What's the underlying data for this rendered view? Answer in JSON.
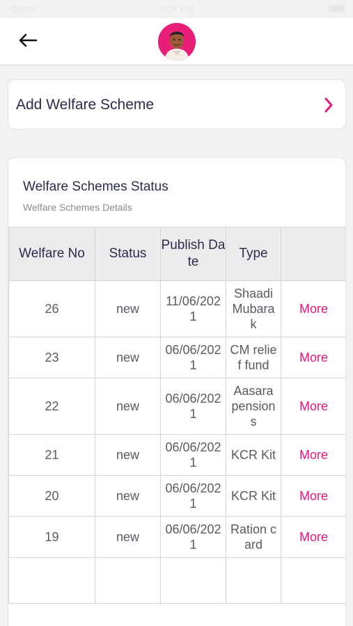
{
  "status_bar": {
    "carrier": "Carrier",
    "time": "7:34 PM"
  },
  "header": {
    "back_icon": "arrow-left-icon",
    "avatar_icon": "profile-avatar",
    "accent_color": "#e91e78"
  },
  "add_card": {
    "label": "Add Welfare Scheme",
    "chevron_icon": "chevron-right-icon",
    "chevron_color": "#e6197a"
  },
  "status_card": {
    "title": "Welfare Schemes Status",
    "subtitle": "Welfare Schemes Details",
    "columns": [
      "Welfare No",
      "Status",
      "Publish Date",
      "Type",
      ""
    ],
    "rows": [
      {
        "no": "26",
        "status": "new",
        "date": "11/06/2021",
        "type": "Shaadi Mubarak",
        "action": "More"
      },
      {
        "no": "23",
        "status": "new",
        "date": "06/06/2021",
        "type": "CM relief fund",
        "action": "More"
      },
      {
        "no": "22",
        "status": "new",
        "date": "06/06/2021",
        "type": "Aasara pensions",
        "action": "More"
      },
      {
        "no": "21",
        "status": "new",
        "date": "06/06/2021",
        "type": "KCR Kit",
        "action": "More"
      },
      {
        "no": "20",
        "status": "new",
        "date": "06/06/2021",
        "type": "KCR Kit",
        "action": "More"
      },
      {
        "no": "19",
        "status": "new",
        "date": "06/06/2021",
        "type": "Ration card",
        "action": "More"
      },
      {
        "no": "",
        "status": "",
        "date": "",
        "type": "",
        "action": ""
      }
    ]
  }
}
